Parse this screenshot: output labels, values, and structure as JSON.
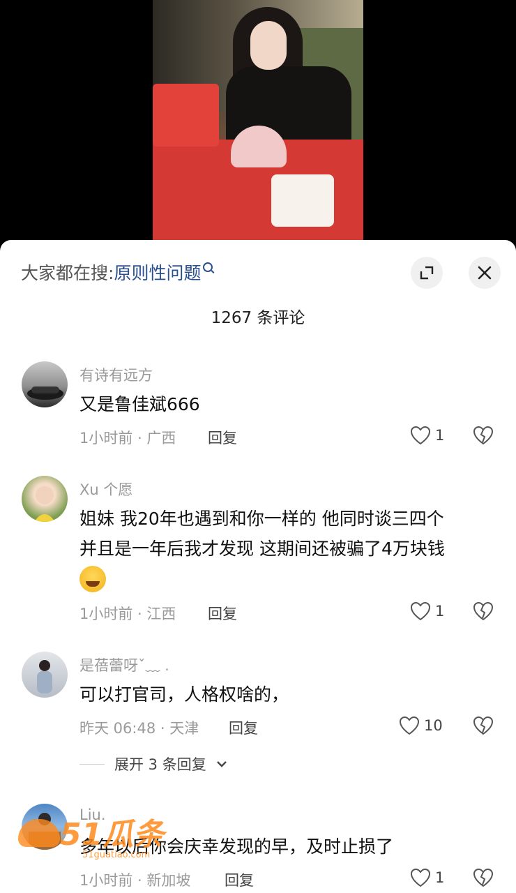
{
  "search": {
    "prefix": "大家都在搜:",
    "term": "原则性问题"
  },
  "comment_count": "1267 条评论",
  "comments": [
    {
      "user": "有诗有远方",
      "text": "又是鲁佳斌666",
      "time_location": "1小时前 · 广西",
      "reply": "回复",
      "likes": "1"
    },
    {
      "user": "Xu 个愿",
      "text_line1": "姐妹 我20年也遇到和你一样的 他同时谈三四个",
      "text_line2": "并且是一年后我才发现 这期间还被骗了4万块钱",
      "time_location": "1小时前 · 江西",
      "reply": "回复",
      "likes": "1"
    },
    {
      "user": "是蓓蕾呀ˇ﹏ .",
      "text": "可以打官司，人格权啥的，",
      "time_location": "昨天 06:48 · 天津",
      "reply": "回复",
      "likes": "10",
      "expand": "展开 3 条回复"
    },
    {
      "user": "Liu.",
      "text": "多年以后你会庆幸发现的早，及时止损了",
      "time_location": "1小时前 · 新加坡",
      "reply": "回复",
      "likes": "1"
    }
  ],
  "watermark": {
    "logo_text": "51瓜条",
    "url": "51guatiao.com"
  },
  "colors": {
    "link": "#2a4f8f",
    "meta": "#9a9a9a",
    "watermark": "#ff8a1e"
  }
}
